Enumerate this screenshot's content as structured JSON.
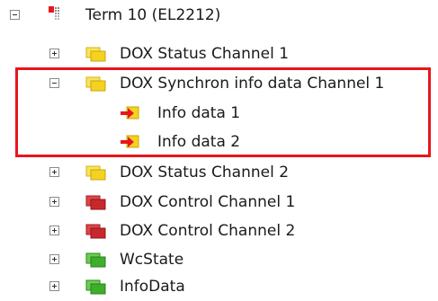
{
  "tree": {
    "root": {
      "label": "Term 10 (EL2212)",
      "expanded": true,
      "icon": "terminal-icon",
      "icon_colors": [
        "#e8161c",
        "#7a7a7a"
      ]
    },
    "children": [
      {
        "label": "DOX Status Channel 1",
        "expanded": false,
        "icon": "folder-yellow-icon",
        "color": "#f4d21f"
      },
      {
        "label": "DOX Synchron info data Channel 1",
        "expanded": true,
        "icon": "folder-yellow-icon",
        "color": "#f4d21f",
        "children": [
          {
            "label": "Info data 1",
            "icon": "input-variable-icon"
          },
          {
            "label": "Info data 2",
            "icon": "input-variable-icon"
          }
        ]
      },
      {
        "label": "DOX Status Channel 2",
        "expanded": false,
        "icon": "folder-yellow-icon",
        "color": "#f4d21f"
      },
      {
        "label": "DOX Control Channel 1",
        "expanded": false,
        "icon": "folder-red-icon",
        "color": "#c8282d"
      },
      {
        "label": "DOX Control Channel 2",
        "expanded": false,
        "icon": "folder-red-icon",
        "color": "#c8282d"
      },
      {
        "label": "WcState",
        "expanded": false,
        "icon": "folder-green-icon",
        "color": "#3fae2a"
      },
      {
        "label": "InfoData",
        "expanded": false,
        "icon": "folder-green-icon",
        "color": "#3fae2a"
      }
    ]
  },
  "highlight": {
    "color": "#e8161c"
  }
}
